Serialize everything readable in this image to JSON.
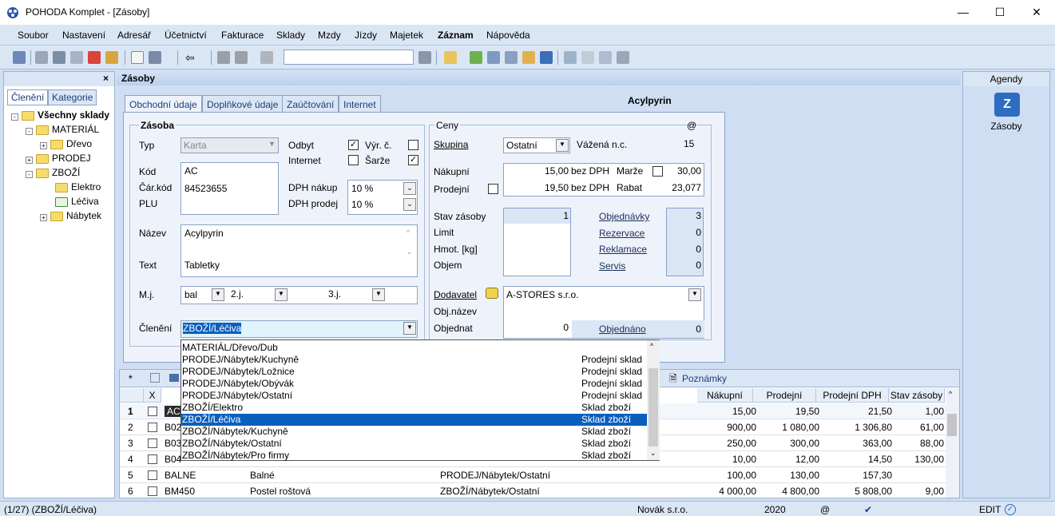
{
  "window": {
    "title": "POHODA Komplet - [Zásoby]"
  },
  "menu": [
    "Soubor",
    "Nastavení",
    "Adresář",
    "Účetnictví",
    "Fakturace",
    "Sklady",
    "Mzdy",
    "Jízdy",
    "Majetek",
    "Záznam",
    "Nápověda"
  ],
  "left": {
    "tabs": [
      "Členění",
      "Kategorie"
    ],
    "close": "×",
    "tree": [
      "Všechny sklady",
      "MATERIÁL",
      "Dřevo",
      "PRODEJ",
      "ZBOŽÍ",
      "Elektro",
      "Léčiva",
      "Nábytek"
    ]
  },
  "agenda": {
    "title": "Zásoby",
    "record_name": "Acylpyrin",
    "tabs": [
      "Obchodní údaje",
      "Doplňkové údaje",
      "Zaúčtování",
      "Internet"
    ]
  },
  "form": {
    "zasoba_title": "Zásoba",
    "typ_label": "Typ",
    "typ_value": "Karta",
    "odbyt_label": "Odbyt",
    "internet_label": "Internet",
    "vyr_label": "Výr. č.",
    "sarze_label": "Šarže",
    "kod_label": "Kód",
    "kod_value": "AC",
    "car_label": "Čár.kód",
    "car_value": "84523655",
    "plu_label": "PLU",
    "dph_nakup_label": "DPH nákup",
    "dph_nakup_value": "10 %",
    "dph_prodej_label": "DPH prodej",
    "dph_prodej_value": "10 %",
    "nazev_label": "Název",
    "nazev_value": "Acylpyrin",
    "text_label": "Text",
    "text_value": "Tabletky",
    "mj_label": "M.j.",
    "mj_value": "bal",
    "j2_label": "2.j.",
    "j3_label": "3.j.",
    "cleneni_label": "Členění",
    "cleneni_value": "ZBOŽÍ/Léčiva"
  },
  "prices": {
    "title": "Ceny",
    "at": "@",
    "skupina_label": "Skupina",
    "skupina_value": "Ostatní",
    "vazena_label": "Vážená n.c.",
    "vazena_value": "15",
    "nakupni_label": "Nákupní",
    "nakupni_value": "15,00",
    "bez_dph1": "bez DPH",
    "marze_label": "Marže",
    "marze_value": "30,00",
    "prodejni_label": "Prodejní",
    "prodejni_value": "19,50",
    "bez_dph2": "bez DPH",
    "rabat_label": "Rabat",
    "rabat_value": "23,077",
    "stav_label": "Stav zásoby",
    "stav_value": "1",
    "limit_label": "Limit",
    "hmot_label": "Hmot. [kg]",
    "objem_label": "Objem",
    "obj_label": "Objednávky",
    "obj_value": "3",
    "rez_label": "Rezervace",
    "rez_value": "0",
    "rekl_label": "Reklamace",
    "rekl_value": "0",
    "serv_label": "Servis",
    "serv_value": "0",
    "dod_label": "Dodavatel",
    "dod_value": "A-STORES s.r.o.",
    "objnazev_label": "Obj.název",
    "objednat_label": "Objednat",
    "objednat_value": "0",
    "objednano_label": "Objednáno",
    "objednano_value": "0"
  },
  "popup": [
    {
      "path": "MATERIÁL/Dřevo/Dub",
      "store": ""
    },
    {
      "path": "PRODEJ/Nábytek/Kuchyně",
      "store": "Prodejní sklad"
    },
    {
      "path": "PRODEJ/Nábytek/Ložnice",
      "store": "Prodejní sklad"
    },
    {
      "path": "PRODEJ/Nábytek/Obývák",
      "store": "Prodejní sklad"
    },
    {
      "path": "PRODEJ/Nábytek/Ostatní",
      "store": "Prodejní sklad"
    },
    {
      "path": "ZBOŽÍ/Elektro",
      "store": "Sklad zboží"
    },
    {
      "path": "ZBOŽÍ/Léčiva",
      "store": "Sklad zboží"
    },
    {
      "path": "ZBOŽÍ/Nábytek/Kuchyně",
      "store": "Sklad zboží"
    },
    {
      "path": "ZBOŽÍ/Nábytek/Ostatní",
      "store": "Sklad zboží"
    },
    {
      "path": "ZBOŽÍ/Nábytek/Pro firmy",
      "store": "Sklad zboží"
    }
  ],
  "grid": {
    "star": "*",
    "tab_notes": "Poznámky",
    "x_col": "X",
    "columns": [
      "Nákupní",
      "Prodejní",
      "Prodejní DPH",
      "Stav zásoby"
    ],
    "rows": [
      {
        "n": "1",
        "code": "AC",
        "name": "",
        "cat": "",
        "buy": "15,00",
        "sell": "19,50",
        "sellvat": "21,50",
        "stock": "1,00"
      },
      {
        "n": "2",
        "code": "B02",
        "name": "",
        "cat": "",
        "buy": "900,00",
        "sell": "1 080,00",
        "sellvat": "1 306,80",
        "stock": "61,00"
      },
      {
        "n": "3",
        "code": "B03",
        "name": "",
        "cat": "",
        "buy": "250,00",
        "sell": "300,00",
        "sellvat": "363,00",
        "stock": "88,00"
      },
      {
        "n": "4",
        "code": "B04",
        "name": "",
        "cat": "",
        "buy": "10,00",
        "sell": "12,00",
        "sellvat": "14,50",
        "stock": "130,00"
      },
      {
        "n": "5",
        "code": "BALNE",
        "name": "Balné",
        "cat": "PRODEJ/Nábytek/Ostatní",
        "buy": "100,00",
        "sell": "130,00",
        "sellvat": "157,30",
        "stock": ""
      },
      {
        "n": "6",
        "code": "BM450",
        "name": "Postel roštová",
        "cat": "ZBOŽÍ/Nábytek/Ostatní",
        "buy": "4 000,00",
        "sell": "4 800,00",
        "sellvat": "5 808,00",
        "stock": "9,00"
      }
    ]
  },
  "right": {
    "title": "Agendy",
    "item": "Zásoby"
  },
  "status": {
    "left": "(1/27) (ZBOŽÍ/Léčiva)",
    "company": "Novák s.r.o.",
    "year": "2020",
    "at": "@",
    "mode": "EDIT"
  }
}
